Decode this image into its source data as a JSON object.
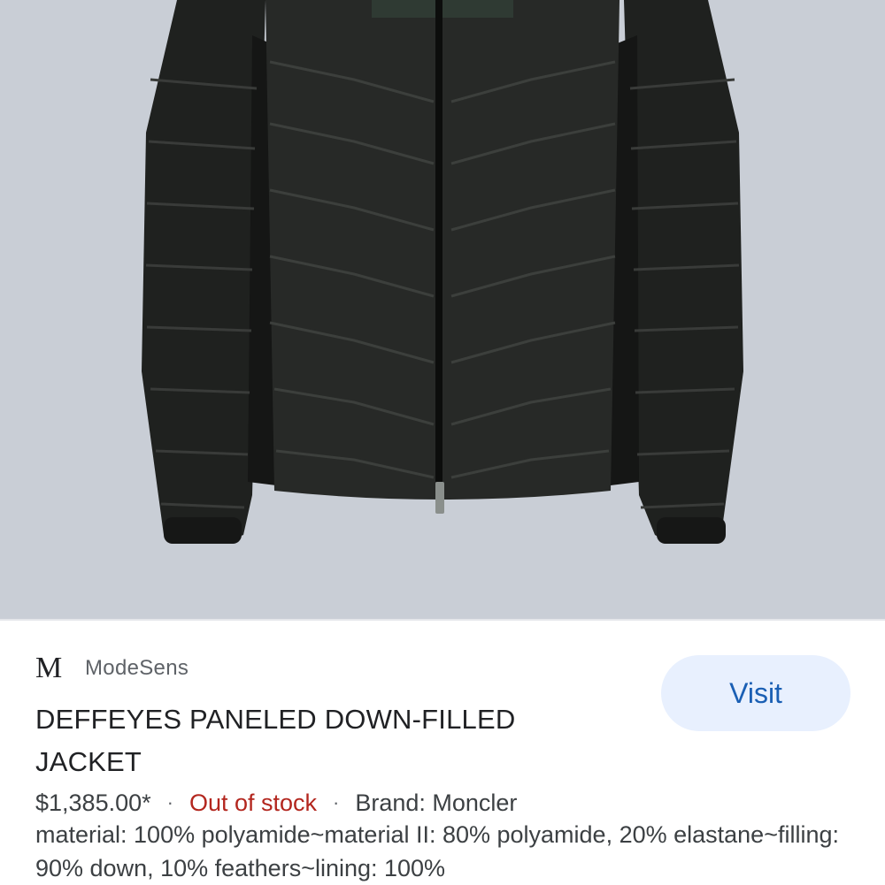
{
  "product_image": {
    "alt": "DEFFEYES PANELED DOWN-FILLED JACKET",
    "background_color": "#c9ced6",
    "jacket_color": "#232523"
  },
  "source": {
    "logo_letter": "M",
    "name": "ModeSens"
  },
  "visit_button": {
    "label": "Visit"
  },
  "product": {
    "title": "DEFFEYES PANELED DOWN-FILLED JACKET",
    "price": "$1,385.00*",
    "separator": "·",
    "stock_status": "Out of stock",
    "brand": "Brand: Moncler",
    "description": "material: 100% polyamide~material II: 80% polyamide, 20% elastane~filling: 90% down, 10% feathers~lining: 100%"
  },
  "colors": {
    "visit_bg": "#e8f0fe",
    "visit_text": "#1a5fb4",
    "out_of_stock": "#b3261e"
  }
}
